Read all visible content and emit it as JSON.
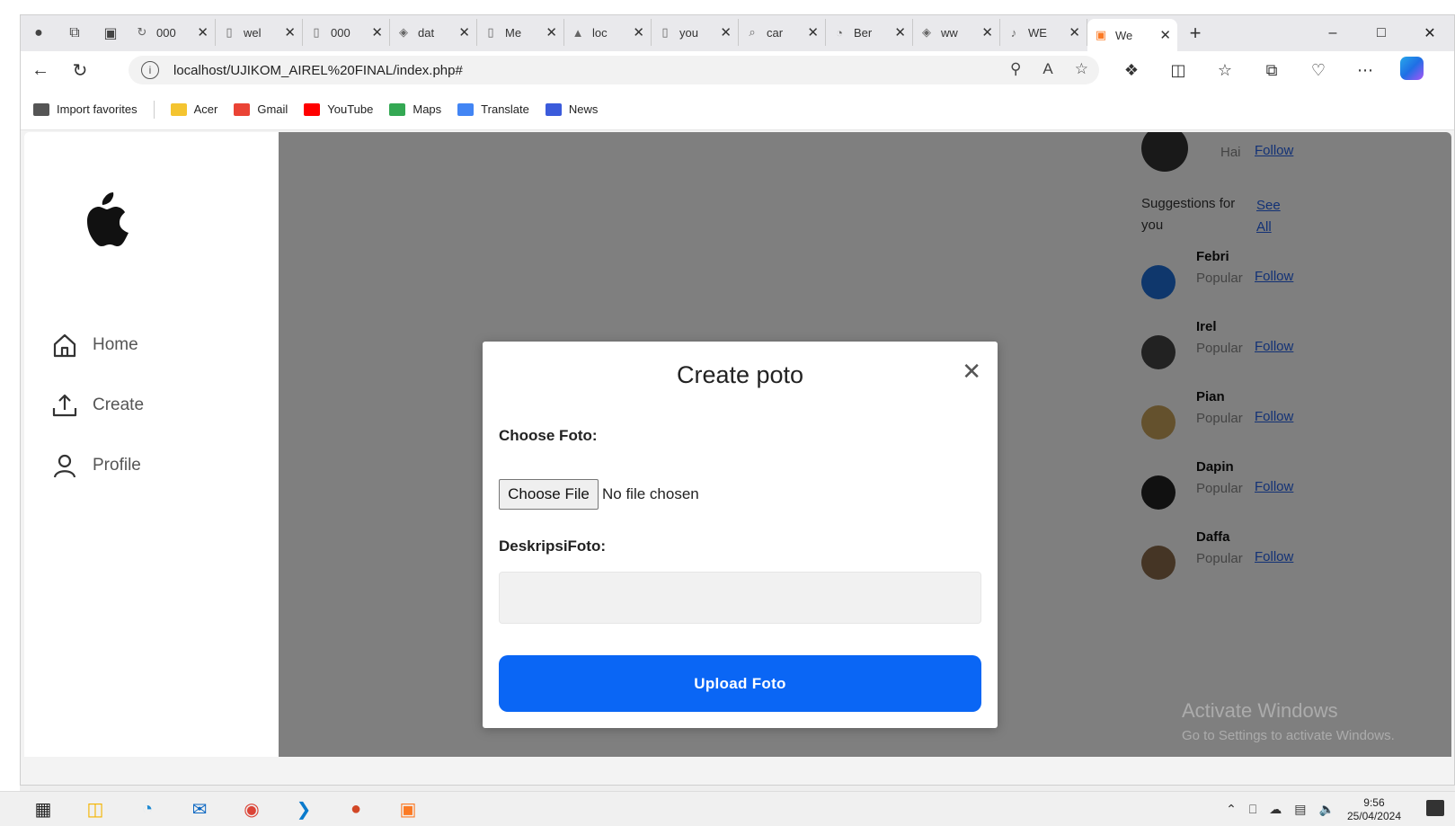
{
  "browser": {
    "tabs": [
      {
        "title": "000",
        "icon": "refresh-icon"
      },
      {
        "title": "wel",
        "icon": "page-icon"
      },
      {
        "title": "000",
        "icon": "page-icon"
      },
      {
        "title": "dat",
        "icon": "db-icon"
      },
      {
        "title": "Me",
        "icon": "page-icon"
      },
      {
        "title": "loc",
        "icon": "pma-icon"
      },
      {
        "title": "you",
        "icon": "page-icon"
      },
      {
        "title": "car",
        "icon": "search-icon"
      },
      {
        "title": "Ber",
        "icon": "edge-icon"
      },
      {
        "title": "ww",
        "icon": "db-icon"
      },
      {
        "title": "WE",
        "icon": "music-icon"
      },
      {
        "title": "We",
        "icon": "xampp-icon",
        "active": true
      }
    ],
    "url": "localhost/UJIKOM_AIREL%20FINAL/index.php#",
    "favorites": [
      {
        "label": "Import favorites",
        "color": "#555555"
      },
      {
        "label": "Acer",
        "color": "#f4c430"
      },
      {
        "label": "Gmail",
        "color": "#ea4335"
      },
      {
        "label": "YouTube",
        "color": "#ff0000"
      },
      {
        "label": "Maps",
        "color": "#34a853"
      },
      {
        "label": "Translate",
        "color": "#4285f4"
      },
      {
        "label": "News",
        "color": "#3b5bdb"
      }
    ]
  },
  "sidebar": {
    "items": [
      {
        "label": "Home"
      },
      {
        "label": "Create"
      },
      {
        "label": "Profile"
      }
    ]
  },
  "suggestions": {
    "top_user": {
      "sub": "Hai",
      "follow": "Follow"
    },
    "heading": "Suggestions for you",
    "heading_line1": "Suggestions for",
    "heading_line2": "you",
    "see_all_line1": "See",
    "see_all_line2": "All",
    "users": [
      {
        "name": "Febri",
        "sub": "Popular",
        "follow": "Follow",
        "avatar_color": "#1e6fd9"
      },
      {
        "name": "Irel",
        "sub": "Popular",
        "follow": "Follow",
        "avatar_color": "#444444"
      },
      {
        "name": "Pian",
        "sub": "Popular",
        "follow": "Follow",
        "avatar_color": "#c9a25a"
      },
      {
        "name": "Dapin",
        "sub": "Popular",
        "follow": "Follow",
        "avatar_color": "#222222"
      },
      {
        "name": "Daffa",
        "sub": "Popular",
        "follow": "Follow",
        "avatar_color": "#8a6a4a"
      }
    ]
  },
  "modal": {
    "title": "Create poto",
    "choose_label": "Choose Foto:",
    "file_button": "Choose File",
    "file_status": "No file chosen",
    "desc_label": "DeskripsiFoto:",
    "desc_value": "",
    "upload_button": "Upload Foto",
    "accent": "#0a66f5"
  },
  "watermark": {
    "line1": "Activate Windows",
    "line2": "Go to Settings to activate Windows."
  },
  "taskbar": {
    "time": "9:56",
    "date": "25/04/2024"
  }
}
